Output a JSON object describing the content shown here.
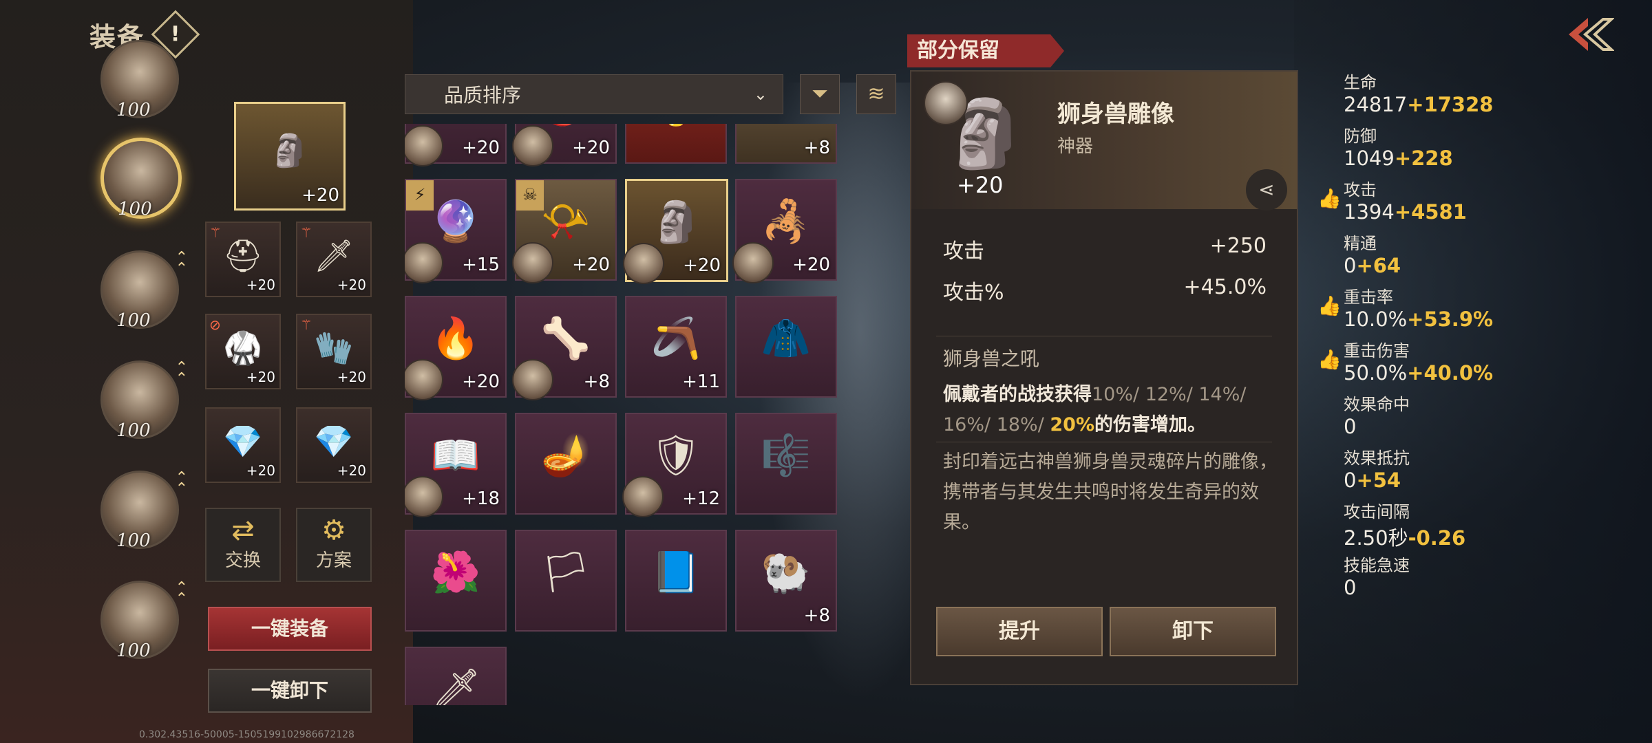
{
  "header": {
    "title": "装备",
    "warn_icon": "!"
  },
  "heroes": [
    {
      "level": "100",
      "upgradeable": false,
      "selected": false
    },
    {
      "level": "100",
      "upgradeable": false,
      "selected": true
    },
    {
      "level": "100",
      "upgradeable": true,
      "selected": false
    },
    {
      "level": "100",
      "upgradeable": true,
      "selected": false
    },
    {
      "level": "100",
      "upgradeable": true,
      "selected": false
    },
    {
      "level": "100",
      "upgradeable": true,
      "selected": false
    }
  ],
  "equipped": {
    "artifact": {
      "plus": "+20",
      "icon": "sphinx-statue-icon"
    },
    "slots": [
      {
        "plus": "+20",
        "icon": "helmet-icon"
      },
      {
        "plus": "+20",
        "icon": "weapon-icon"
      },
      {
        "plus": "+20",
        "icon": "armor-icon"
      },
      {
        "plus": "+20",
        "icon": "gauntlet-icon"
      },
      {
        "plus": "+20",
        "icon": "gem-icon"
      },
      {
        "plus": "+20",
        "icon": "gem-icon"
      }
    ]
  },
  "buttons": {
    "exchange": "交换",
    "preset": "方案",
    "equip_all": "一键装备",
    "unequip_all": "一键卸下"
  },
  "build_id": "0.302.43516-50005-1505199102986672128",
  "sort": {
    "label": "品质排序"
  },
  "grid": [
    {
      "plus": "+20",
      "style": "",
      "owner": true,
      "badge": ""
    },
    {
      "plus": "+20",
      "style": "",
      "owner": true,
      "badge": ""
    },
    {
      "plus": "",
      "style": "red",
      "owner": false,
      "badge": ""
    },
    {
      "plus": "+8",
      "style": "tan",
      "owner": false,
      "badge": ""
    },
    {
      "plus": "+15",
      "style": "",
      "owner": true,
      "badge": "⚡"
    },
    {
      "plus": "+20",
      "style": "tan",
      "owner": true,
      "badge": "☠"
    },
    {
      "plus": "+20",
      "style": "gold",
      "owner": true,
      "badge": ""
    },
    {
      "plus": "+20",
      "style": "",
      "owner": true,
      "badge": ""
    },
    {
      "plus": "+20",
      "style": "",
      "owner": true,
      "badge": ""
    },
    {
      "plus": "+8",
      "style": "",
      "owner": true,
      "badge": ""
    },
    {
      "plus": "+11",
      "style": "",
      "owner": false,
      "badge": ""
    },
    {
      "plus": "",
      "style": "",
      "owner": false,
      "badge": ""
    },
    {
      "plus": "+18",
      "style": "",
      "owner": true,
      "badge": ""
    },
    {
      "plus": "",
      "style": "",
      "owner": false,
      "badge": ""
    },
    {
      "plus": "+12",
      "style": "",
      "owner": true,
      "badge": ""
    },
    {
      "plus": "",
      "style": "",
      "owner": false,
      "badge": ""
    },
    {
      "plus": "",
      "style": "",
      "owner": false,
      "badge": ""
    },
    {
      "plus": "",
      "style": "",
      "owner": false,
      "badge": ""
    },
    {
      "plus": "",
      "style": "",
      "owner": false,
      "badge": ""
    },
    {
      "plus": "+8",
      "style": "",
      "owner": false,
      "badge": ""
    },
    {
      "plus": "",
      "style": "",
      "owner": false,
      "badge": ""
    }
  ],
  "detail": {
    "keep_tab": "部分保留",
    "name": "狮身兽雕像",
    "type": "神器",
    "plus": "+20",
    "stats": [
      {
        "name": "攻击",
        "value": "+250"
      },
      {
        "name": "攻击%",
        "value": "+45.0%"
      }
    ],
    "skill_name": "狮身兽之吼",
    "skill_desc_a": "佩戴者的战技获得",
    "skill_desc_b": "10%/ 12%/ 14%/ 16%/ 18%/ ",
    "skill_desc_c": "20%",
    "skill_desc_d": "的伤害增加。",
    "lore": "封印着远古神兽狮身兽灵魂碎片的雕像，携带者与其发生共鸣时将发生奇异的效果。",
    "upgrade": "提升",
    "unequip": "卸下"
  },
  "stats": [
    {
      "name": "生命",
      "base": "24817",
      "bonus": "+17328",
      "thumb": false
    },
    {
      "name": "防御",
      "base": "1049",
      "bonus": "+228",
      "thumb": false
    },
    {
      "name": "攻击",
      "base": "1394",
      "bonus": "+4581",
      "thumb": true
    },
    {
      "name": "精通",
      "base": "0",
      "bonus": "+64",
      "thumb": false
    },
    {
      "name": "重击率",
      "base": "10.0%",
      "bonus": "+53.9%",
      "thumb": true
    },
    {
      "name": "重击伤害",
      "base": "50.0%",
      "bonus": "+40.0%",
      "thumb": true
    },
    {
      "name": "效果命中",
      "base": "0",
      "bonus": "",
      "thumb": false
    },
    {
      "name": "效果抵抗",
      "base": "0",
      "bonus": "+54",
      "thumb": false
    },
    {
      "name": "攻击间隔",
      "base": "2.50秒",
      "bonus": "-0.26",
      "thumb": false
    },
    {
      "name": "技能急速",
      "base": "0",
      "bonus": "",
      "thumb": false
    }
  ]
}
